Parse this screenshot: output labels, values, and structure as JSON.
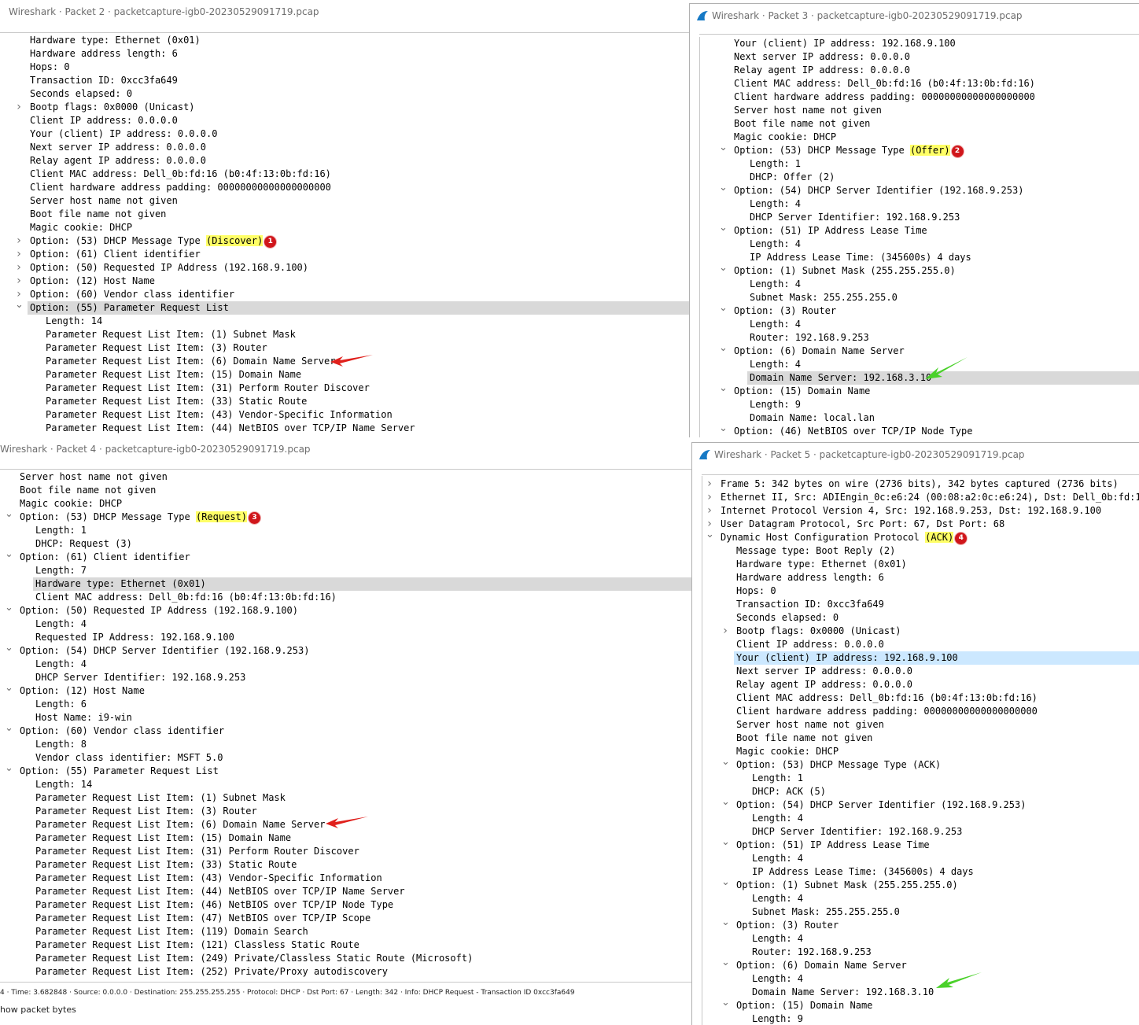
{
  "windows": [
    {
      "id": "packet2",
      "title": "Wireshark · Packet 2 · packetcapture-igb0-20230529091719.pcap",
      "rows": [
        {
          "text": "Hardware type: Ethernet (0x01)",
          "indent": 0
        },
        {
          "text": "Hardware address length: 6",
          "indent": 0
        },
        {
          "text": "Hops: 0",
          "indent": 0
        },
        {
          "text": "Transaction ID: 0xcc3fa649",
          "indent": 0
        },
        {
          "text": "Seconds elapsed: 0",
          "indent": 0
        },
        {
          "text": "Bootp flags: 0x0000 (Unicast)",
          "indent": 0,
          "expander": "collapsed"
        },
        {
          "text": "Client IP address: 0.0.0.0",
          "indent": 0
        },
        {
          "text": "Your (client) IP address: 0.0.0.0",
          "indent": 0
        },
        {
          "text": "Next server IP address: 0.0.0.0",
          "indent": 0
        },
        {
          "text": "Relay agent IP address: 0.0.0.0",
          "indent": 0
        },
        {
          "text": "Client MAC address: Dell_0b:fd:16 (b0:4f:13:0b:fd:16)",
          "indent": 0
        },
        {
          "text": "Client hardware address padding: 00000000000000000000",
          "indent": 0
        },
        {
          "text": "Server host name not given",
          "indent": 0
        },
        {
          "text": "Boot file name not given",
          "indent": 0
        },
        {
          "text": "Magic cookie: DHCP",
          "indent": 0
        },
        {
          "text": "Option: (53) DHCP Message Type ",
          "indent": 0,
          "expander": "collapsed",
          "highlight": "(Discover)",
          "badge": "1"
        },
        {
          "text": "Option: (61) Client identifier",
          "indent": 0,
          "expander": "collapsed"
        },
        {
          "text": "Option: (50) Requested IP Address (192.168.9.100)",
          "indent": 0,
          "expander": "collapsed"
        },
        {
          "text": "Option: (12) Host Name",
          "indent": 0,
          "expander": "collapsed"
        },
        {
          "text": "Option: (60) Vendor class identifier",
          "indent": 0,
          "expander": "collapsed"
        },
        {
          "text": "Option: (55) Parameter Request List",
          "indent": 0,
          "expander": "expanded",
          "selected": "gray"
        },
        {
          "text": "Length: 14",
          "indent": 1
        },
        {
          "text": "Parameter Request List Item: (1) Subnet Mask",
          "indent": 1
        },
        {
          "text": "Parameter Request List Item: (3) Router",
          "indent": 1
        },
        {
          "text": "Parameter Request List Item: (6) Domain Name Server",
          "indent": 1
        },
        {
          "text": "Parameter Request List Item: (15) Domain Name",
          "indent": 1
        },
        {
          "text": "Parameter Request List Item: (31) Perform Router Discover",
          "indent": 1
        },
        {
          "text": "Parameter Request List Item: (33) Static Route",
          "indent": 1
        },
        {
          "text": "Parameter Request List Item: (43) Vendor-Specific Information",
          "indent": 1
        },
        {
          "text": "Parameter Request List Item: (44) NetBIOS over TCP/IP Name Server",
          "indent": 1
        }
      ]
    },
    {
      "id": "packet3",
      "title": "Wireshark · Packet 3 · packetcapture-igb0-20230529091719.pcap",
      "rows": [
        {
          "text": "Your (client) IP address: 192.168.9.100",
          "indent": 0
        },
        {
          "text": "Next server IP address: 0.0.0.0",
          "indent": 0
        },
        {
          "text": "Relay agent IP address: 0.0.0.0",
          "indent": 0
        },
        {
          "text": "Client MAC address: Dell_0b:fd:16 (b0:4f:13:0b:fd:16)",
          "indent": 0
        },
        {
          "text": "Client hardware address padding: 00000000000000000000",
          "indent": 0
        },
        {
          "text": "Server host name not given",
          "indent": 0
        },
        {
          "text": "Boot file name not given",
          "indent": 0
        },
        {
          "text": "Magic cookie: DHCP",
          "indent": 0
        },
        {
          "text": "Option: (53) DHCP Message Type ",
          "indent": 0,
          "expander": "expanded",
          "highlight": "(Offer)",
          "badge": "2"
        },
        {
          "text": "Length: 1",
          "indent": 1
        },
        {
          "text": "DHCP: Offer (2)",
          "indent": 1
        },
        {
          "text": "Option: (54) DHCP Server Identifier (192.168.9.253)",
          "indent": 0,
          "expander": "expanded"
        },
        {
          "text": "Length: 4",
          "indent": 1
        },
        {
          "text": "DHCP Server Identifier: 192.168.9.253",
          "indent": 1
        },
        {
          "text": "Option: (51) IP Address Lease Time",
          "indent": 0,
          "expander": "expanded"
        },
        {
          "text": "Length: 4",
          "indent": 1
        },
        {
          "text": "IP Address Lease Time: (345600s) 4 days",
          "indent": 1
        },
        {
          "text": "Option: (1) Subnet Mask (255.255.255.0)",
          "indent": 0,
          "expander": "expanded"
        },
        {
          "text": "Length: 4",
          "indent": 1
        },
        {
          "text": "Subnet Mask: 255.255.255.0",
          "indent": 1
        },
        {
          "text": "Option: (3) Router",
          "indent": 0,
          "expander": "expanded"
        },
        {
          "text": "Length: 4",
          "indent": 1
        },
        {
          "text": "Router: 192.168.9.253",
          "indent": 1
        },
        {
          "text": "Option: (6) Domain Name Server",
          "indent": 0,
          "expander": "expanded"
        },
        {
          "text": "Length: 4",
          "indent": 1
        },
        {
          "text": "Domain Name Server: 192.168.3.10",
          "indent": 1,
          "selected": "gray"
        },
        {
          "text": "Option: (15) Domain Name",
          "indent": 0,
          "expander": "expanded"
        },
        {
          "text": "Length: 9",
          "indent": 1
        },
        {
          "text": "Domain Name: local.lan",
          "indent": 1
        },
        {
          "text": "Option: (46) NetBIOS over TCP/IP Node Type",
          "indent": 0,
          "expander": "expanded"
        }
      ]
    },
    {
      "id": "packet4",
      "title": "Wireshark · Packet 4 · packetcapture-igb0-20230529091719.pcap",
      "status": "4 · Time: 3.682848 · Source: 0.0.0.0 · Destination: 255.255.255.255 · Protocol: DHCP · Dst Port: 67 · Length: 342 · Info: DHCP Request - Transaction ID 0xcc3fa649",
      "checkbox_label": "how packet bytes",
      "rows": [
        {
          "text": "Server host name not given",
          "indent": 0
        },
        {
          "text": "Boot file name not given",
          "indent": 0
        },
        {
          "text": "Magic cookie: DHCP",
          "indent": 0
        },
        {
          "text": "Option: (53) DHCP Message Type ",
          "indent": 0,
          "expander": "expanded",
          "highlight": "(Request)",
          "badge": "3"
        },
        {
          "text": "Length: 1",
          "indent": 1
        },
        {
          "text": "DHCP: Request (3)",
          "indent": 1
        },
        {
          "text": "Option: (61) Client identifier",
          "indent": 0,
          "expander": "expanded"
        },
        {
          "text": "Length: 7",
          "indent": 1
        },
        {
          "text": "Hardware type: Ethernet (0x01)",
          "indent": 1,
          "selected": "gray"
        },
        {
          "text": "Client MAC address: Dell_0b:fd:16 (b0:4f:13:0b:fd:16)",
          "indent": 1
        },
        {
          "text": "Option: (50) Requested IP Address (192.168.9.100)",
          "indent": 0,
          "expander": "expanded"
        },
        {
          "text": "Length: 4",
          "indent": 1
        },
        {
          "text": "Requested IP Address: 192.168.9.100",
          "indent": 1
        },
        {
          "text": "Option: (54) DHCP Server Identifier (192.168.9.253)",
          "indent": 0,
          "expander": "expanded"
        },
        {
          "text": "Length: 4",
          "indent": 1
        },
        {
          "text": "DHCP Server Identifier: 192.168.9.253",
          "indent": 1
        },
        {
          "text": "Option: (12) Host Name",
          "indent": 0,
          "expander": "expanded"
        },
        {
          "text": "Length: 6",
          "indent": 1
        },
        {
          "text": "Host Name: i9-win",
          "indent": 1
        },
        {
          "text": "Option: (60) Vendor class identifier",
          "indent": 0,
          "expander": "expanded"
        },
        {
          "text": "Length: 8",
          "indent": 1
        },
        {
          "text": "Vendor class identifier: MSFT 5.0",
          "indent": 1
        },
        {
          "text": "Option: (55) Parameter Request List",
          "indent": 0,
          "expander": "expanded"
        },
        {
          "text": "Length: 14",
          "indent": 1
        },
        {
          "text": "Parameter Request List Item: (1) Subnet Mask",
          "indent": 1
        },
        {
          "text": "Parameter Request List Item: (3) Router",
          "indent": 1
        },
        {
          "text": "Parameter Request List Item: (6) Domain Name Server",
          "indent": 1
        },
        {
          "text": "Parameter Request List Item: (15) Domain Name",
          "indent": 1
        },
        {
          "text": "Parameter Request List Item: (31) Perform Router Discover",
          "indent": 1
        },
        {
          "text": "Parameter Request List Item: (33) Static Route",
          "indent": 1
        },
        {
          "text": "Parameter Request List Item: (43) Vendor-Specific Information",
          "indent": 1
        },
        {
          "text": "Parameter Request List Item: (44) NetBIOS over TCP/IP Name Server",
          "indent": 1
        },
        {
          "text": "Parameter Request List Item: (46) NetBIOS over TCP/IP Node Type",
          "indent": 1
        },
        {
          "text": "Parameter Request List Item: (47) NetBIOS over TCP/IP Scope",
          "indent": 1
        },
        {
          "text": "Parameter Request List Item: (119) Domain Search",
          "indent": 1
        },
        {
          "text": "Parameter Request List Item: (121) Classless Static Route",
          "indent": 1
        },
        {
          "text": "Parameter Request List Item: (249) Private/Classless Static Route (Microsoft)",
          "indent": 1
        },
        {
          "text": "Parameter Request List Item: (252) Private/Proxy autodiscovery",
          "indent": 1
        }
      ]
    },
    {
      "id": "packet5",
      "title": "Wireshark · Packet 5 · packetcapture-igb0-20230529091719.pcap",
      "rows": [
        {
          "text": "Frame 5: 342 bytes on wire (2736 bits), 342 bytes captured (2736 bits)",
          "indent": 0,
          "expander": "collapsed"
        },
        {
          "text": "Ethernet II, Src: ADIEngin_0c:e6:24 (00:08:a2:0c:e6:24), Dst: Dell_0b:fd:16",
          "indent": 0,
          "expander": "collapsed"
        },
        {
          "text": "Internet Protocol Version 4, Src: 192.168.9.253, Dst: 192.168.9.100",
          "indent": 0,
          "expander": "collapsed"
        },
        {
          "text": "User Datagram Protocol, Src Port: 67, Dst Port: 68",
          "indent": 0,
          "expander": "collapsed"
        },
        {
          "text": "Dynamic Host Configuration Protocol ",
          "indent": 0,
          "expander": "expanded",
          "highlight": "(ACK)",
          "badge": "4"
        },
        {
          "text": "Message type: Boot Reply (2)",
          "indent": 1
        },
        {
          "text": "Hardware type: Ethernet (0x01)",
          "indent": 1
        },
        {
          "text": "Hardware address length: 6",
          "indent": 1
        },
        {
          "text": "Hops: 0",
          "indent": 1
        },
        {
          "text": "Transaction ID: 0xcc3fa649",
          "indent": 1
        },
        {
          "text": "Seconds elapsed: 0",
          "indent": 1
        },
        {
          "text": "Bootp flags: 0x0000 (Unicast)",
          "indent": 1,
          "expander": "collapsed"
        },
        {
          "text": "Client IP address: 0.0.0.0",
          "indent": 1
        },
        {
          "text": "Your (client) IP address: 192.168.9.100",
          "indent": 1,
          "selected": "blue"
        },
        {
          "text": "Next server IP address: 0.0.0.0",
          "indent": 1
        },
        {
          "text": "Relay agent IP address: 0.0.0.0",
          "indent": 1
        },
        {
          "text": "Client MAC address: Dell_0b:fd:16 (b0:4f:13:0b:fd:16)",
          "indent": 1
        },
        {
          "text": "Client hardware address padding: 00000000000000000000",
          "indent": 1
        },
        {
          "text": "Server host name not given",
          "indent": 1
        },
        {
          "text": "Boot file name not given",
          "indent": 1
        },
        {
          "text": "Magic cookie: DHCP",
          "indent": 1
        },
        {
          "text": "Option: (53) DHCP Message Type (ACK)",
          "indent": 1,
          "expander": "expanded"
        },
        {
          "text": "Length: 1",
          "indent": 2
        },
        {
          "text": "DHCP: ACK (5)",
          "indent": 2
        },
        {
          "text": "Option: (54) DHCP Server Identifier (192.168.9.253)",
          "indent": 1,
          "expander": "expanded"
        },
        {
          "text": "Length: 4",
          "indent": 2
        },
        {
          "text": "DHCP Server Identifier: 192.168.9.253",
          "indent": 2
        },
        {
          "text": "Option: (51) IP Address Lease Time",
          "indent": 1,
          "expander": "expanded"
        },
        {
          "text": "Length: 4",
          "indent": 2
        },
        {
          "text": "IP Address Lease Time: (345600s) 4 days",
          "indent": 2
        },
        {
          "text": "Option: (1) Subnet Mask (255.255.255.0)",
          "indent": 1,
          "expander": "expanded"
        },
        {
          "text": "Length: 4",
          "indent": 2
        },
        {
          "text": "Subnet Mask: 255.255.255.0",
          "indent": 2
        },
        {
          "text": "Option: (3) Router",
          "indent": 1,
          "expander": "expanded"
        },
        {
          "text": "Length: 4",
          "indent": 2
        },
        {
          "text": "Router: 192.168.9.253",
          "indent": 2
        },
        {
          "text": "Option: (6) Domain Name Server",
          "indent": 1,
          "expander": "expanded"
        },
        {
          "text": "Length: 4",
          "indent": 2
        },
        {
          "text": "Domain Name Server: 192.168.3.10",
          "indent": 2
        },
        {
          "text": "Option: (15) Domain Name",
          "indent": 1,
          "expander": "expanded"
        },
        {
          "text": "Length: 9",
          "indent": 2
        }
      ]
    }
  ],
  "annotations": {
    "red_arrow_color": "#e0201c",
    "green_arrow_color": "#4ad12a",
    "highlight_color": "#ffff66",
    "badge_color": "#d0161b"
  },
  "icons": {
    "app_icon": "wireshark-fin-icon",
    "expanded": "chevron-down-icon",
    "collapsed": "chevron-right-icon"
  }
}
